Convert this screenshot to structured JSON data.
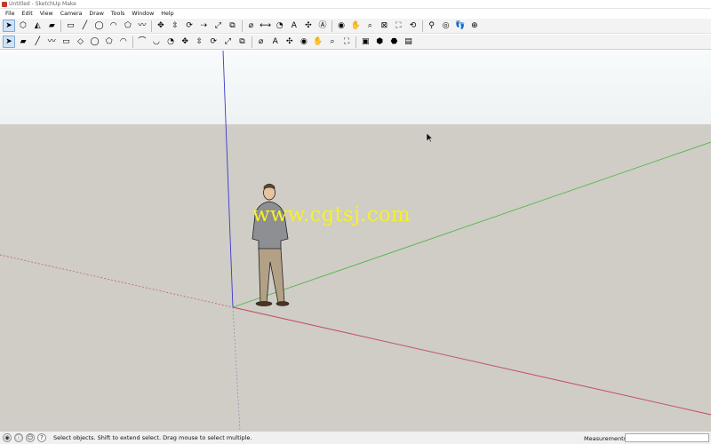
{
  "window": {
    "title": "Untitled - SketchUp Make"
  },
  "menu": [
    "File",
    "Edit",
    "View",
    "Camera",
    "Draw",
    "Tools",
    "Window",
    "Help"
  ],
  "toolbar_row1": [
    {
      "name": "select-tool",
      "glyph": "➤",
      "active": true
    },
    {
      "name": "make-component-tool",
      "glyph": "⬡"
    },
    {
      "name": "paint-bucket-tool",
      "glyph": "◭"
    },
    {
      "name": "eraser-tool",
      "glyph": "▰"
    },
    {
      "sep": true
    },
    {
      "name": "rectangle-tool",
      "glyph": "▭"
    },
    {
      "name": "line-tool",
      "glyph": "╱"
    },
    {
      "name": "circle-tool",
      "glyph": "◯"
    },
    {
      "name": "arc-tool",
      "glyph": "◠"
    },
    {
      "name": "polygon-tool",
      "glyph": "⬠"
    },
    {
      "name": "freehand-tool",
      "glyph": "〰"
    },
    {
      "sep": true
    },
    {
      "name": "move-tool",
      "glyph": "✥"
    },
    {
      "name": "push-pull-tool",
      "glyph": "⇳"
    },
    {
      "name": "rotate-tool",
      "glyph": "⟳"
    },
    {
      "name": "follow-me-tool",
      "glyph": "⇢"
    },
    {
      "name": "scale-tool",
      "glyph": "⤢"
    },
    {
      "name": "offset-tool",
      "glyph": "⧉"
    },
    {
      "sep": true
    },
    {
      "name": "tape-measure-tool",
      "glyph": "⌀"
    },
    {
      "name": "dimension-tool",
      "glyph": "⟷"
    },
    {
      "name": "protractor-tool",
      "glyph": "◔"
    },
    {
      "name": "text-tool",
      "glyph": "A"
    },
    {
      "name": "axes-tool",
      "glyph": "✣"
    },
    {
      "name": "3d-text-tool",
      "glyph": "Ⓐ"
    },
    {
      "sep": true
    },
    {
      "name": "orbit-tool",
      "glyph": "◉"
    },
    {
      "name": "pan-tool",
      "glyph": "✋"
    },
    {
      "name": "zoom-tool",
      "glyph": "⌕"
    },
    {
      "name": "zoom-window-tool",
      "glyph": "⊠"
    },
    {
      "name": "zoom-extents-tool",
      "glyph": "⛶"
    },
    {
      "name": "previous-view-tool",
      "glyph": "⟲"
    },
    {
      "sep": true
    },
    {
      "name": "position-camera-tool",
      "glyph": "⚲"
    },
    {
      "name": "look-around-tool",
      "glyph": "◎"
    },
    {
      "name": "walk-tool",
      "glyph": "👣"
    },
    {
      "name": "section-plane-tool",
      "glyph": "⊕"
    }
  ],
  "toolbar_row2": [
    {
      "name": "select-tool-2",
      "glyph": "➤",
      "active": true
    },
    {
      "name": "eraser-tool-2",
      "glyph": "▰"
    },
    {
      "name": "line-tool-2",
      "glyph": "╱"
    },
    {
      "name": "freehand-tool-2",
      "glyph": "〰"
    },
    {
      "name": "rectangle-tool-2",
      "glyph": "▭"
    },
    {
      "name": "rotated-rectangle-tool",
      "glyph": "◇"
    },
    {
      "name": "circle-tool-2",
      "glyph": "◯"
    },
    {
      "name": "polygon-tool-2",
      "glyph": "⬠"
    },
    {
      "name": "arc-tool-2",
      "glyph": "◠"
    },
    {
      "sep": true
    },
    {
      "name": "two-point-arc-tool",
      "glyph": "⌒"
    },
    {
      "name": "three-point-arc-tool",
      "glyph": "◡"
    },
    {
      "name": "pie-tool",
      "glyph": "◔"
    },
    {
      "name": "move-tool-2",
      "glyph": "✥"
    },
    {
      "name": "push-pull-tool-2",
      "glyph": "⇳"
    },
    {
      "name": "rotate-tool-2",
      "glyph": "⟳"
    },
    {
      "name": "scale-tool-2",
      "glyph": "⤢"
    },
    {
      "name": "offset-tool-2",
      "glyph": "⧉"
    },
    {
      "sep": true
    },
    {
      "name": "tape-measure-tool-2",
      "glyph": "⌀"
    },
    {
      "name": "text-tool-2",
      "glyph": "A"
    },
    {
      "name": "axes-tool-2",
      "glyph": "✣"
    },
    {
      "name": "orbit-tool-2",
      "glyph": "◉"
    },
    {
      "name": "pan-tool-2",
      "glyph": "✋"
    },
    {
      "name": "zoom-tool-2",
      "glyph": "⌕"
    },
    {
      "name": "zoom-extents-tool-2",
      "glyph": "⛶"
    },
    {
      "sep": true
    },
    {
      "name": "components-tool",
      "glyph": "▣"
    },
    {
      "name": "get-models-tool",
      "glyph": "⬢"
    },
    {
      "name": "share-model-tool",
      "glyph": "⬣"
    },
    {
      "name": "extension-warehouse-tool",
      "glyph": "▤"
    }
  ],
  "viewport": {
    "watermark": "www.cgtsj.com",
    "colors": {
      "sky": "#f4f7f8",
      "ground": "#cfcdc6",
      "red_axis": "#c0485a",
      "green_axis": "#55b54a",
      "blue_axis": "#3a3ac8"
    }
  },
  "statusbar": {
    "icons": [
      "geo-location-icon",
      "credits-icon",
      "user-icon",
      "help-icon"
    ],
    "message": "Select objects. Shift to extend select. Drag mouse to select multiple.",
    "measurements_label": "Measurements",
    "measurements_value": ""
  }
}
